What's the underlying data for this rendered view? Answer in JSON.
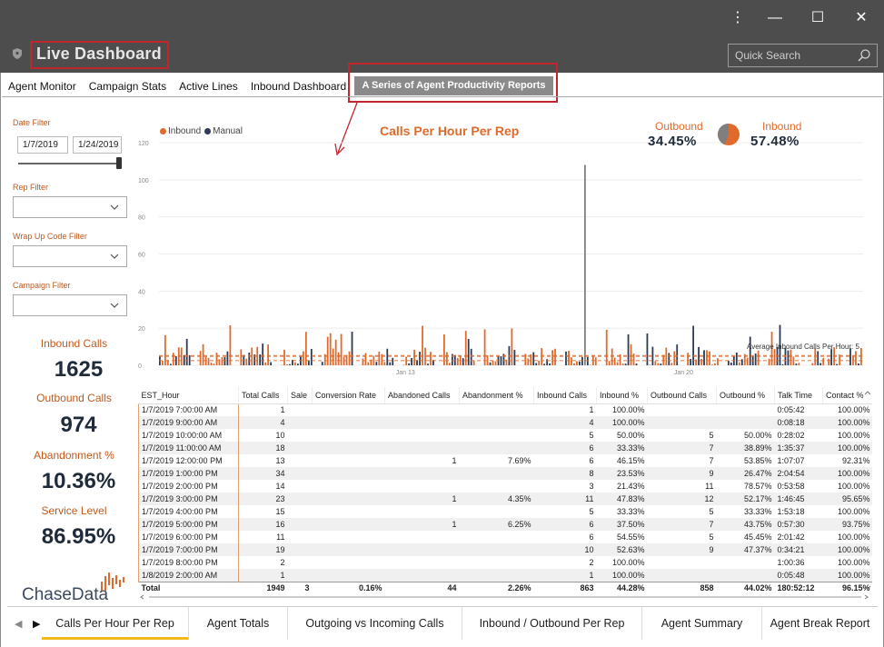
{
  "app": {
    "title": "Live Dashboard",
    "search_placeholder": "Quick Search"
  },
  "window_controls": {
    "more": "⋮",
    "minimize": "—",
    "maximize": "☐",
    "close": "✕"
  },
  "nav": {
    "items": [
      {
        "label": "Agent Monitor"
      },
      {
        "label": "Campaign Stats"
      },
      {
        "label": "Active Lines"
      },
      {
        "label": "Inbound Dashboard"
      }
    ],
    "active_label": "A Series of Agent Productivity Reports"
  },
  "filters": {
    "date_label": "Date Filter",
    "date_start": "1/7/2019",
    "date_end": "1/24/2019",
    "rep_label": "Rep Filter",
    "wrap_label": "Wrap Up Code Filter",
    "campaign_label": "Campaign Filter"
  },
  "kpis": [
    {
      "label": "Inbound Calls",
      "value": "1625"
    },
    {
      "label": "Outbound Calls",
      "value": "974"
    },
    {
      "label": "Abandonment %",
      "value": "10.36%"
    },
    {
      "label": "Service Level",
      "value": "86.95%"
    }
  ],
  "logo": {
    "text": "ChaseData"
  },
  "chart": {
    "title": "Calls Per Hour Per Rep",
    "legend_inbound": "Inbound",
    "legend_manual": "Manual",
    "outbound_label": "Outbound",
    "outbound_value": "34.45%",
    "inbound_label": "Inbound",
    "inbound_value": "57.48%",
    "avg_label": "Average Inbound Calls Per Hour: 5",
    "colors": {
      "inbound": "#e06a2b",
      "manual": "#2b3a55",
      "pie_gray": "#7f7f7f"
    }
  },
  "chart_data": {
    "type": "bar",
    "series": [
      {
        "name": "Inbound"
      },
      {
        "name": "Manual"
      }
    ],
    "yticks": [
      "120",
      "100",
      "80",
      "60",
      "40",
      "20",
      "0"
    ],
    "xticks": [
      "Jan 13",
      "Jan 20"
    ],
    "ylim": [
      0,
      120
    ],
    "average_inbound_per_hour": 5,
    "pie": {
      "outbound": 34.45,
      "inbound": 57.48
    }
  },
  "table": {
    "columns": [
      "EST_Hour",
      "Total Calls",
      "Sale",
      "Conversion Rate",
      "Abandoned Calls",
      "Abandonment %",
      "Inbound Calls",
      "Inbound %",
      "Outbound Calls",
      "Outbound %",
      "Talk Time",
      "Contact %"
    ],
    "rows": [
      [
        "1/7/2019 7:00:00 AM",
        "1",
        "",
        "",
        "",
        "",
        "1",
        "100.00%",
        "",
        "",
        "0:05:42",
        "100.00%"
      ],
      [
        "1/7/2019 9:00:00 AM",
        "4",
        "",
        "",
        "",
        "",
        "4",
        "100.00%",
        "",
        "",
        "0:08:18",
        "100.00%"
      ],
      [
        "1/7/2019 10:00:00 AM",
        "10",
        "",
        "",
        "",
        "",
        "5",
        "50.00%",
        "5",
        "50.00%",
        "0:28:02",
        "100.00%"
      ],
      [
        "1/7/2019 11:00:00 AM",
        "18",
        "",
        "",
        "",
        "",
        "6",
        "33.33%",
        "7",
        "38.89%",
        "1:35:37",
        "100.00%"
      ],
      [
        "1/7/2019 12:00:00 PM",
        "13",
        "",
        "",
        "1",
        "7.69%",
        "6",
        "46.15%",
        "7",
        "53.85%",
        "1:07:07",
        "92.31%"
      ],
      [
        "1/7/2019 1:00:00 PM",
        "34",
        "",
        "",
        "",
        "",
        "8",
        "23.53%",
        "9",
        "26.47%",
        "2:04:54",
        "100.00%"
      ],
      [
        "1/7/2019 2:00:00 PM",
        "14",
        "",
        "",
        "",
        "",
        "3",
        "21.43%",
        "11",
        "78.57%",
        "0:53:58",
        "100.00%"
      ],
      [
        "1/7/2019 3:00:00 PM",
        "23",
        "",
        "",
        "1",
        "4.35%",
        "11",
        "47.83%",
        "12",
        "52.17%",
        "1:46:45",
        "95.65%"
      ],
      [
        "1/7/2019 4:00:00 PM",
        "15",
        "",
        "",
        "",
        "",
        "5",
        "33.33%",
        "5",
        "33.33%",
        "1:53:18",
        "100.00%"
      ],
      [
        "1/7/2019 5:00:00 PM",
        "16",
        "",
        "",
        "1",
        "6.25%",
        "6",
        "37.50%",
        "7",
        "43.75%",
        "0:57:30",
        "93.75%"
      ],
      [
        "1/7/2019 6:00:00 PM",
        "11",
        "",
        "",
        "",
        "",
        "6",
        "54.55%",
        "5",
        "45.45%",
        "2:01:42",
        "100.00%"
      ],
      [
        "1/7/2019 7:00:00 PM",
        "19",
        "",
        "",
        "",
        "",
        "10",
        "52.63%",
        "9",
        "47.37%",
        "0:34:21",
        "100.00%"
      ],
      [
        "1/7/2019 8:00:00 PM",
        "2",
        "",
        "",
        "",
        "",
        "2",
        "100.00%",
        "",
        "",
        "1:00:36",
        "100.00%"
      ],
      [
        "1/8/2019 2:00:00 AM",
        "1",
        "",
        "",
        "",
        "",
        "1",
        "100.00%",
        "",
        "",
        "0:05:48",
        "100.00%"
      ]
    ],
    "total": [
      "Total",
      "1949",
      "3",
      "0.16%",
      "44",
      "2.26%",
      "863",
      "44.28%",
      "858",
      "44.02%",
      "180:52:12",
      "96.15%"
    ]
  },
  "bottom_tabs": [
    "Calls Per Hour Per Rep",
    "Agent Totals",
    "Outgoing vs Incoming Calls",
    "Inbound / Outbound Per Rep",
    "Agent Summary",
    "Agent Break Report"
  ]
}
